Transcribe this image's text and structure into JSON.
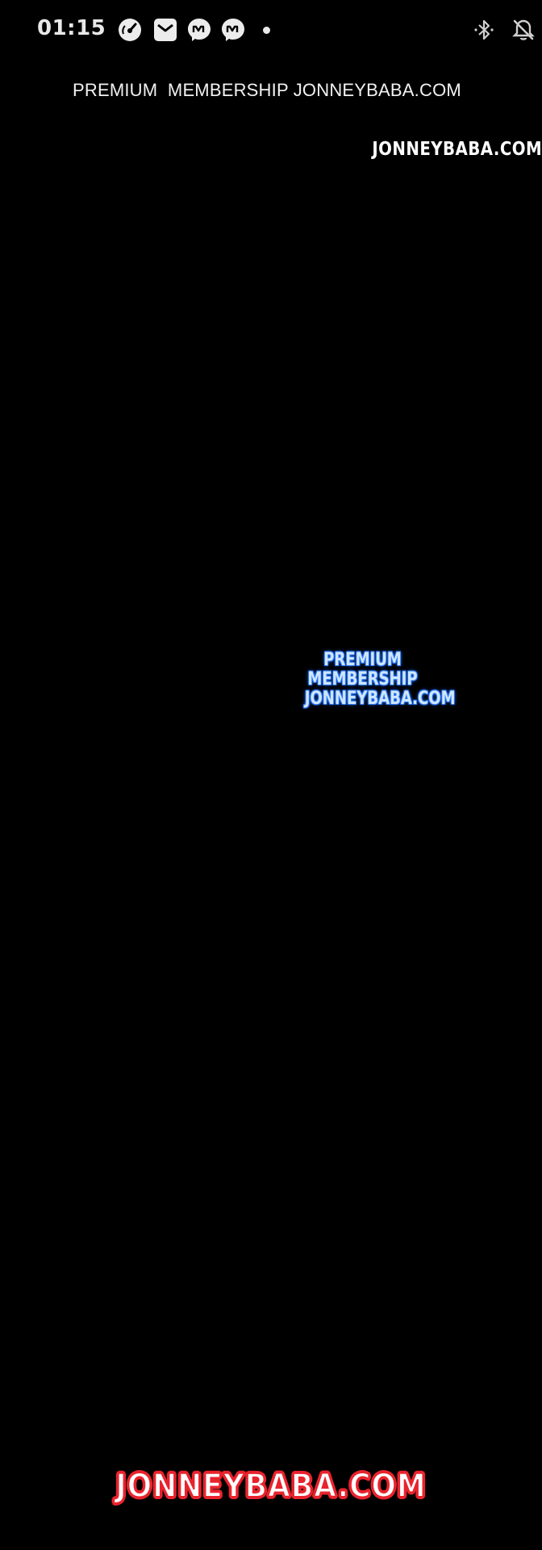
{
  "status_bar": {
    "time": "01:15",
    "notification_icons": [
      "speedometer-icon",
      "mail-icon",
      "messenger-icon",
      "messenger-icon"
    ],
    "system_icons": [
      "bluetooth-icon",
      "notifications-off-icon"
    ]
  },
  "header": {
    "title": "PREMIUM  MEMBERSHIP JONNEYBABA.COM"
  },
  "watermarks": {
    "top_right": "JONNEYBABA.COM",
    "center": {
      "line1": "PREMIUM",
      "line2": "MEMBERSHIP",
      "line3": "JONNEYBABA.COM"
    },
    "bottom": "JONNEYBABA.COM"
  },
  "colors": {
    "background": "#000000",
    "center_watermark_glow": "#2c7dff",
    "bottom_watermark_stroke": "#e8242e"
  }
}
